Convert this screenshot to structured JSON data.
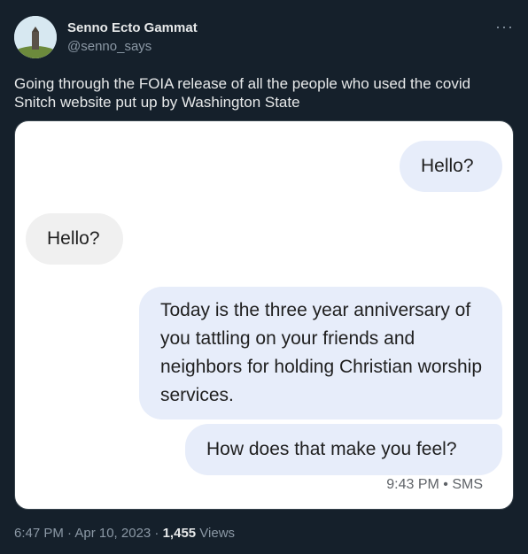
{
  "author": {
    "name": "Senno Ecto Gammat",
    "handle": "@senno_says"
  },
  "more_glyph": "···",
  "tweet_text": "Going through the FOIA release of all the people who used the covid Snitch website put up by Washington State",
  "conversation": {
    "msg1": "Hello?",
    "msg2": "Hello?",
    "msg3": "Today is the three year anniversary of you tattling on your friends and neighbors for holding Christian worship services.",
    "msg4": "How does that make you feel?",
    "meta": "9:43 PM • SMS"
  },
  "footer": {
    "timestamp": "6:47 PM · Apr 10, 2023 · ",
    "views_count": "1,455",
    "views_label": " Views"
  }
}
